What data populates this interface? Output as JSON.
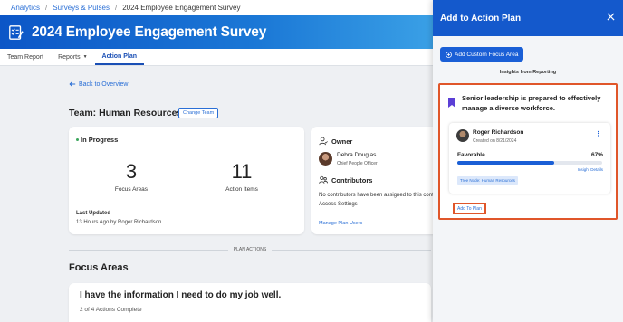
{
  "breadcrumb": {
    "items": [
      "Analytics",
      "Surveys & Pulses"
    ],
    "current": "2024 Employee Engagement Survey"
  },
  "banner": {
    "title": "2024 Employee Engagement Survey",
    "icon": "survey-checklist-icon"
  },
  "tabs": [
    {
      "label": "Team Report",
      "active": false
    },
    {
      "label": "Reports",
      "active": false,
      "has_dropdown": true
    },
    {
      "label": "Action Plan",
      "active": true
    }
  ],
  "main": {
    "back_label": "Back to Overview",
    "team_title": "Team: Human Resources",
    "change_team_label": "Change Team",
    "status": {
      "label": "In Progress",
      "focus_areas_count": "3",
      "focus_areas_label": "Focus Areas",
      "action_items_count": "11",
      "action_items_label": "Action Items",
      "last_updated_label": "Last Updated",
      "last_updated_value": "13 Hours Ago by Roger Richardson"
    },
    "owner": {
      "heading": "Owner",
      "name": "Debra Douglas",
      "role": "Chief People Officer",
      "contributors_heading": "Contributors",
      "contributors_text": "No contributors have been assigned to this contributors from Survey Access Settings",
      "manage_label": "Manage Plan Users"
    },
    "plan_actions_label": "PLAN ACTIONS",
    "focus_areas_heading": "Focus Areas",
    "focus_card": {
      "question": "I have the information I need to do my job well.",
      "progress": "2 of 4 Actions Complete"
    }
  },
  "panel": {
    "title": "Add to Action Plan",
    "add_focus_label": "Add Custom Focus Area",
    "insights_label": "Insights from Reporting",
    "insight": {
      "title": "Senior leadership is prepared to effectively manage a diverse workforce.",
      "author": "Roger Richardson",
      "created": "Created on 8/21/2024",
      "metric_label": "Favorable",
      "metric_value": "67%",
      "metric_fraction": 0.67,
      "details_label": "Insight Details",
      "tree_node": "Tree Node: Human Resources",
      "add_to_plan_label": "Add To Plan"
    }
  },
  "colors": {
    "primary": "#1a5fd6",
    "highlight": "#e0562a",
    "status_green": "#3ba55c",
    "bookmark": "#5b3fd6"
  }
}
